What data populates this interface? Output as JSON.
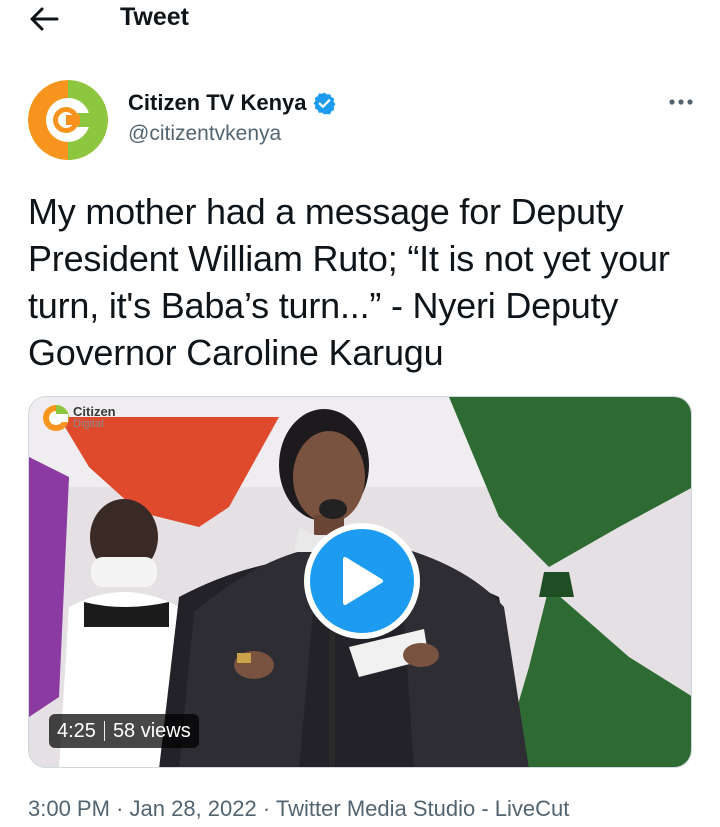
{
  "header": {
    "title": "Tweet",
    "back_icon": "arrow-left-icon"
  },
  "author": {
    "display_name": "Citizen TV Kenya",
    "handle": "@citizentvkenya",
    "verified": true,
    "avatar_colors": {
      "orange": "#f7941d",
      "green": "#8dc63f"
    }
  },
  "tweet": {
    "text": "My mother had a message for Deputy President William Ruto; “It is not yet your turn, it's Baba’s turn...” - Nyeri Deputy Governor Caroline Karugu"
  },
  "media": {
    "watermark_brand": "Citizen",
    "watermark_sub": "Digital",
    "duration": "4:25",
    "views": "58 views",
    "play_icon": "play-icon"
  },
  "meta": {
    "time": "3:00 PM",
    "date": "Jan 28, 2022",
    "source": "Twitter Media Studio - LiveCut",
    "separator": "·"
  },
  "colors": {
    "accent": "#1d9bf0",
    "text_primary": "#0f1419",
    "text_secondary": "#536471"
  }
}
